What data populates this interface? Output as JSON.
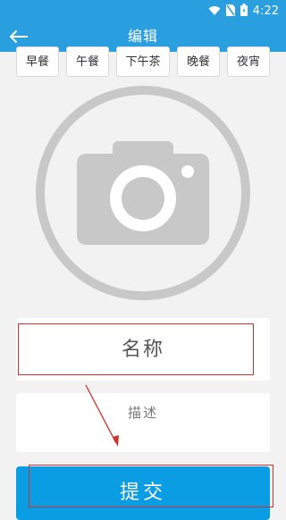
{
  "status_bar": {
    "time": "4:22"
  },
  "app_bar": {
    "title": "编辑"
  },
  "meal_tabs": [
    "早餐",
    "午餐",
    "下午茶",
    "晚餐",
    "夜宵"
  ],
  "form": {
    "name_placeholder": "名称",
    "description_placeholder": "描述"
  },
  "submit_label": "提交",
  "colors": {
    "primary": "#2a9fe0",
    "submit": "#0a9de3",
    "annotation": "#d0312d"
  }
}
